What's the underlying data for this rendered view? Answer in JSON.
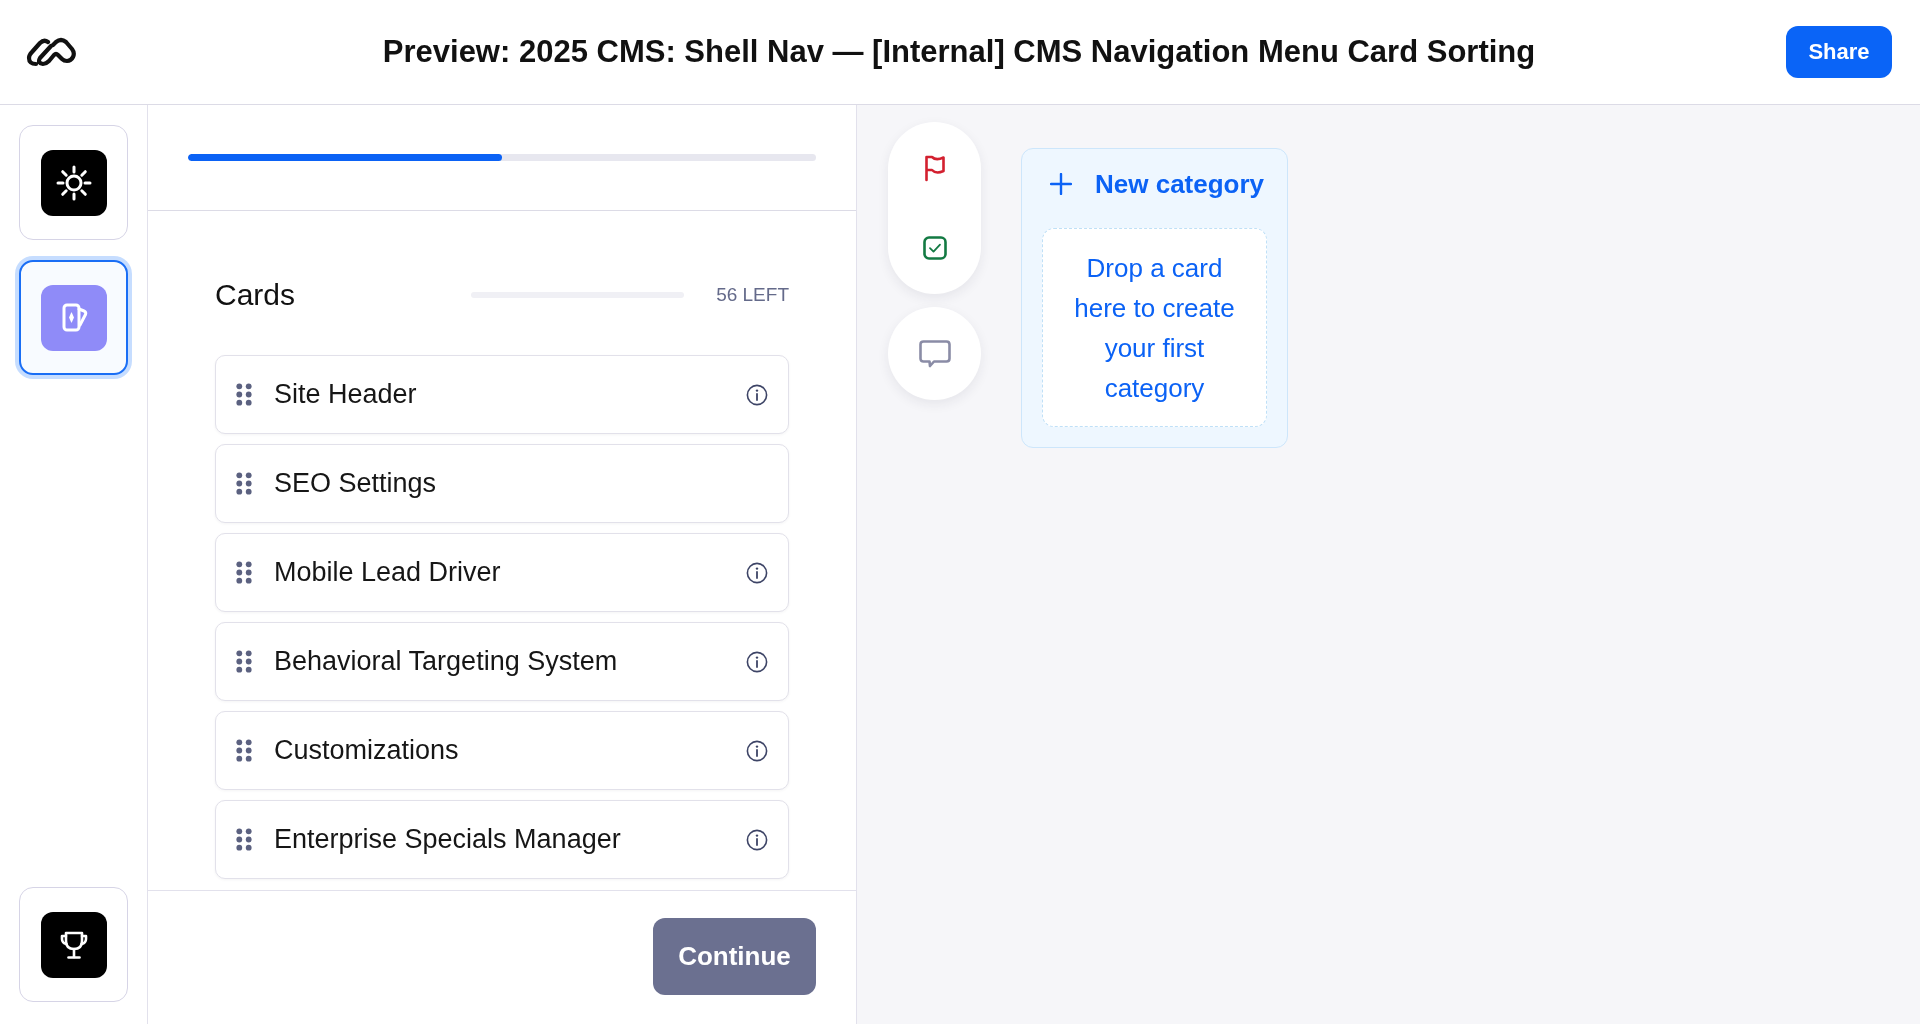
{
  "header": {
    "title": "Preview: 2025 CMS: Shell Nav — [Internal] CMS Navigation Menu Card Sorting",
    "share_button": "Share"
  },
  "rail": {
    "top_items": [
      {
        "kind": "sun",
        "selected": false
      },
      {
        "kind": "card",
        "selected": true
      }
    ],
    "bottom_items": [
      {
        "kind": "trophy",
        "selected": false
      }
    ]
  },
  "progress": {
    "level": 0.5
  },
  "cards_panel": {
    "title": "Cards",
    "remaining": "56 LEFT",
    "cards": [
      {
        "label": "Site Header",
        "info": true
      },
      {
        "label": "SEO Settings",
        "info": false
      },
      {
        "label": "Mobile Lead Driver",
        "info": true
      },
      {
        "label": "Behavioral Targeting System",
        "info": true
      },
      {
        "label": "Customizations",
        "info": true
      },
      {
        "label": "Enterprise Specials Manager",
        "info": true
      }
    ],
    "continue_button": {
      "label": "Continue",
      "disabled": true
    }
  },
  "category_board": {
    "new_category_button": "New category",
    "drop_zone_text": "Drop a card here to create your first category"
  }
}
